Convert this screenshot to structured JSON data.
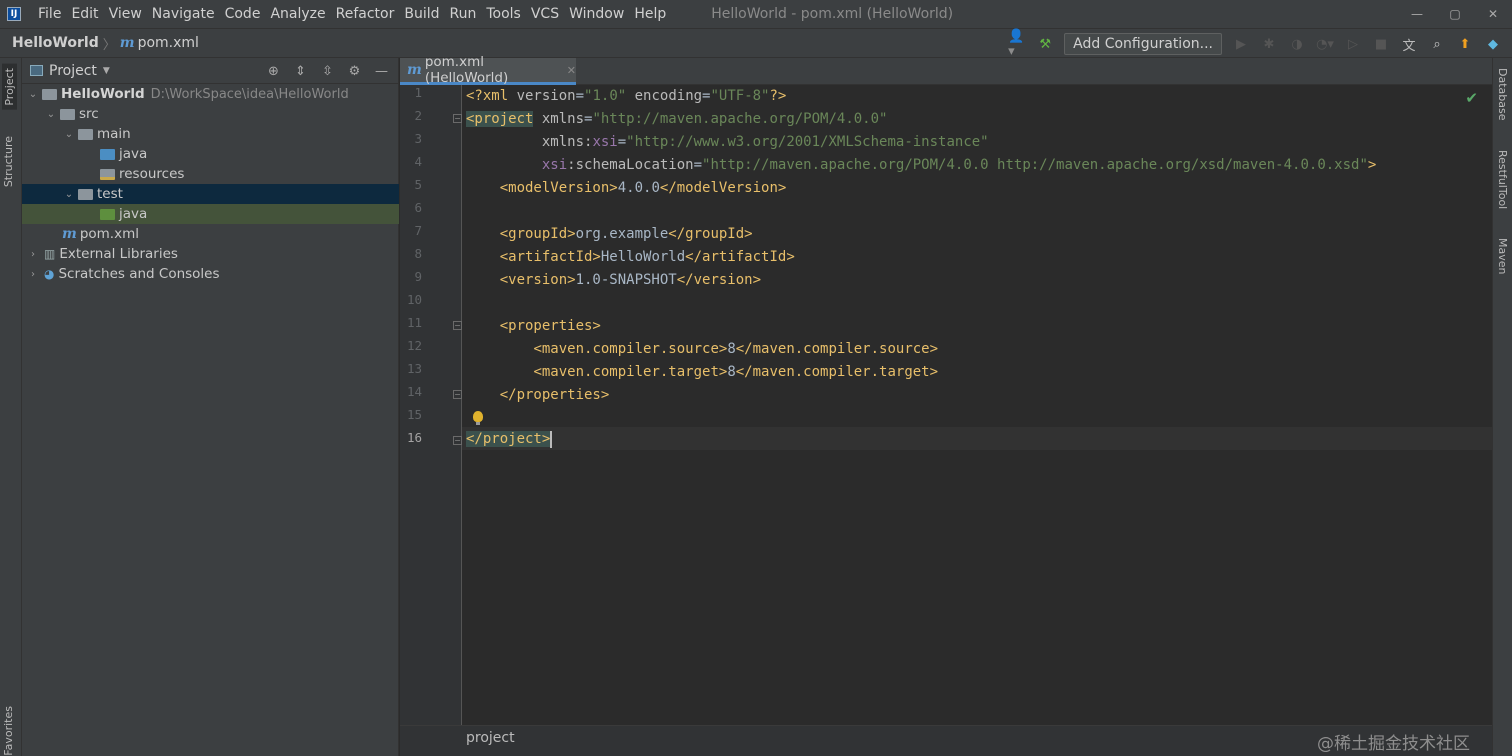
{
  "menubar": {
    "app_icon": "IJ",
    "items": [
      "File",
      "Edit",
      "View",
      "Navigate",
      "Code",
      "Analyze",
      "Refactor",
      "Build",
      "Run",
      "Tools",
      "VCS",
      "Window",
      "Help"
    ],
    "window_title": "HelloWorld - pom.xml (HelloWorld)",
    "controls": [
      "—",
      "▢",
      "✕"
    ]
  },
  "navbar": {
    "project": "HelloWorld",
    "file_icon": "m",
    "file": "pom.xml",
    "add_configuration": "Add Configuration..."
  },
  "left_strip": {
    "project": "Project",
    "structure": "Structure",
    "favorites": "Favorites"
  },
  "right_strip": {
    "database": "Database",
    "restful": "RestfulTool",
    "maven": "Maven"
  },
  "project_panel": {
    "title": "Project",
    "tree": [
      {
        "label": "HelloWorld",
        "path": "D:\\WorkSpace\\idea\\HelloWorld"
      },
      {
        "label": "src"
      },
      {
        "label": "main"
      },
      {
        "label": "java"
      },
      {
        "label": "resources"
      },
      {
        "label": "test"
      },
      {
        "label": "java"
      },
      {
        "label": "pom.xml"
      },
      {
        "label": "External Libraries"
      },
      {
        "label": "Scratches and Consoles"
      }
    ]
  },
  "editor": {
    "tab_label": "pom.xml (HelloWorld)",
    "line_numbers": [
      "1",
      "2",
      "3",
      "4",
      "5",
      "6",
      "7",
      "8",
      "9",
      "10",
      "11",
      "12",
      "13",
      "14",
      "15",
      "16"
    ],
    "code": {
      "l1": {
        "open": "<?xml ",
        "a1": "version",
        "eq1": "=",
        "v1": "\"1.0\"",
        "a2": " encoding",
        "eq2": "=",
        "v2": "\"UTF-8\"",
        "close": "?>"
      },
      "l2": {
        "tag": "<project",
        "a1": " xmlns",
        "eq": "=",
        "v1": "\"http://maven.apache.org/POM/4.0.0\""
      },
      "l3": {
        "indent": "         ",
        "a1": "xmlns:",
        "ns": "xsi",
        "eq": "=",
        "v1": "\"http://www.w3.org/2001/XMLSchema-instance\""
      },
      "l4": {
        "indent": "         ",
        "ns": "xsi",
        "a1": ":schemaLocation",
        "eq": "=",
        "v1": "\"http://maven.apache.org/POM/4.0.0 http://maven.apache.org/xsd/maven-4.0.0.xsd\"",
        "close": ">"
      },
      "l5": {
        "indent": "    ",
        "open": "<modelVersion>",
        "text": "4.0.0",
        "close": "</modelVersion>"
      },
      "l7": {
        "indent": "    ",
        "open": "<groupId>",
        "text": "org.example",
        "close": "</groupId>"
      },
      "l8": {
        "indent": "    ",
        "open": "<artifactId>",
        "text": "HelloWorld",
        "close": "</artifactId>"
      },
      "l9": {
        "indent": "    ",
        "open": "<version>",
        "text": "1.0-SNAPSHOT",
        "close": "</version>"
      },
      "l11": {
        "indent": "    ",
        "open": "<properties>"
      },
      "l12": {
        "indent": "        ",
        "open": "<maven.compiler.source>",
        "text": "8",
        "close": "</maven.compiler.source>"
      },
      "l13": {
        "indent": "        ",
        "open": "<maven.compiler.target>",
        "text": "8",
        "close": "</maven.compiler.target>"
      },
      "l14": {
        "indent": "    ",
        "close": "</properties>"
      },
      "l16": {
        "close": "</project>"
      }
    },
    "footer_breadcrumb": "project",
    "watermark": "@稀土掘金技术社区"
  }
}
